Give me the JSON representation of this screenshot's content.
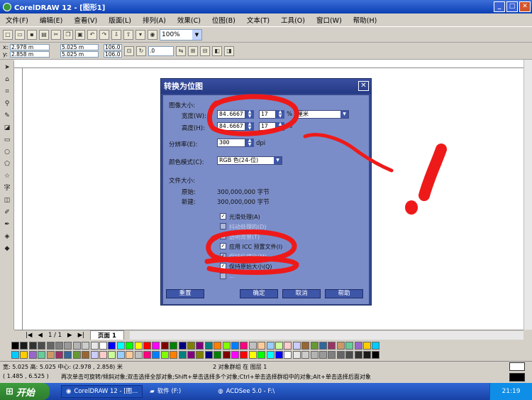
{
  "window": {
    "title": "CorelDRAW 12 - [图形1]"
  },
  "menu": [
    "文件(F)",
    "编辑(E)",
    "查看(V)",
    "版面(L)",
    "排列(A)",
    "效果(C)",
    "位图(B)",
    "文本(T)",
    "工具(O)",
    "窗口(W)",
    "帮助(H)"
  ],
  "toolbar": {
    "zoom": "100%"
  },
  "propbar": {
    "x": "2.978 m",
    "y": "2.858 m",
    "w": "5.025 m",
    "h": "5.025 m",
    "sx": "106.0",
    "sy": "106.0",
    "angle": ".0"
  },
  "dialog": {
    "title": "转换为位图",
    "image_size_label": "图像大小:",
    "width_label": "宽度(W):",
    "height_label": "高度(H):",
    "width_value": "84.6667",
    "height_value": "84.6667",
    "width_pct": "17",
    "height_pct": "17",
    "pct": "%",
    "unit": "厘米",
    "resolution_label": "分辨率(E):",
    "resolution_value": "300",
    "dpi": "dpi",
    "color_mode_label": "颜色模式(C):",
    "color_mode_value": "RGB 色(24-位)",
    "file_size_label": "文件大小:",
    "original_label": "原始:",
    "original_value": "300,000,000 字节",
    "new_label": "新建:",
    "new_value": "300,000,000 字节",
    "checkboxes": [
      {
        "label": "光滑处理(A)",
        "checked": true,
        "enabled": true
      },
      {
        "label": "抖动处理的(D)",
        "checked": false,
        "enabled": false
      },
      {
        "label": "透明背景(T)",
        "checked": false,
        "enabled": false
      },
      {
        "label": "应用 ICC 预置文件(I)",
        "checked": true,
        "enabled": true
      },
      {
        "label": "保持纵横比(M)",
        "checked": true,
        "enabled": false
      },
      {
        "label": "保持原始大小(Q)",
        "checked": true,
        "enabled": true
      },
      {
        "label": "...",
        "checked": false,
        "enabled": false
      }
    ],
    "buttons": {
      "reset": "重置",
      "ok": "确定",
      "cancel": "取消",
      "help": "帮助"
    }
  },
  "pagebar": {
    "count": "1 / 1",
    "tab": "页面 1"
  },
  "status": {
    "size": "宽: 5.025  高: 5.025  中心: (2.978 , 2.858) 米",
    "group": "2 对象群组 在 图层 1",
    "coords": "( 1.485 , 6.525 )",
    "hint": "再次单击可旋转/倾斜对象;双击选择全部对象;Shift+单击选择多个对象;Ctrl+单击选择群组中的对象;Alt+单击选择后面对象"
  },
  "taskbar": {
    "start": "开始",
    "tasks": [
      "CorelDRAW 12 - [图...",
      "软件 (F:)",
      "ACDSee 5.0 - F:\\"
    ],
    "clock": "21:19"
  },
  "palette_colors": [
    "#000000",
    "#1a1a1a",
    "#333333",
    "#4d4d4d",
    "#666666",
    "#808080",
    "#999999",
    "#b3b3b3",
    "#cccccc",
    "#e6e6e6",
    "#ffffff",
    "#0000ff",
    "#00ffff",
    "#00ff00",
    "#ffff00",
    "#ff0000",
    "#ff00ff",
    "#800000",
    "#008000",
    "#000080",
    "#808000",
    "#800080",
    "#008080",
    "#ff8000",
    "#80ff00",
    "#0080ff",
    "#ff0080",
    "#c0c0c0",
    "#ffcc99",
    "#99ccff",
    "#ccff99",
    "#ffcccc",
    "#ccccff",
    "#996633",
    "#669933",
    "#336699",
    "#993366",
    "#cc9966",
    "#66cc99",
    "#9966cc",
    "#ffcc00",
    "#00ccff"
  ]
}
